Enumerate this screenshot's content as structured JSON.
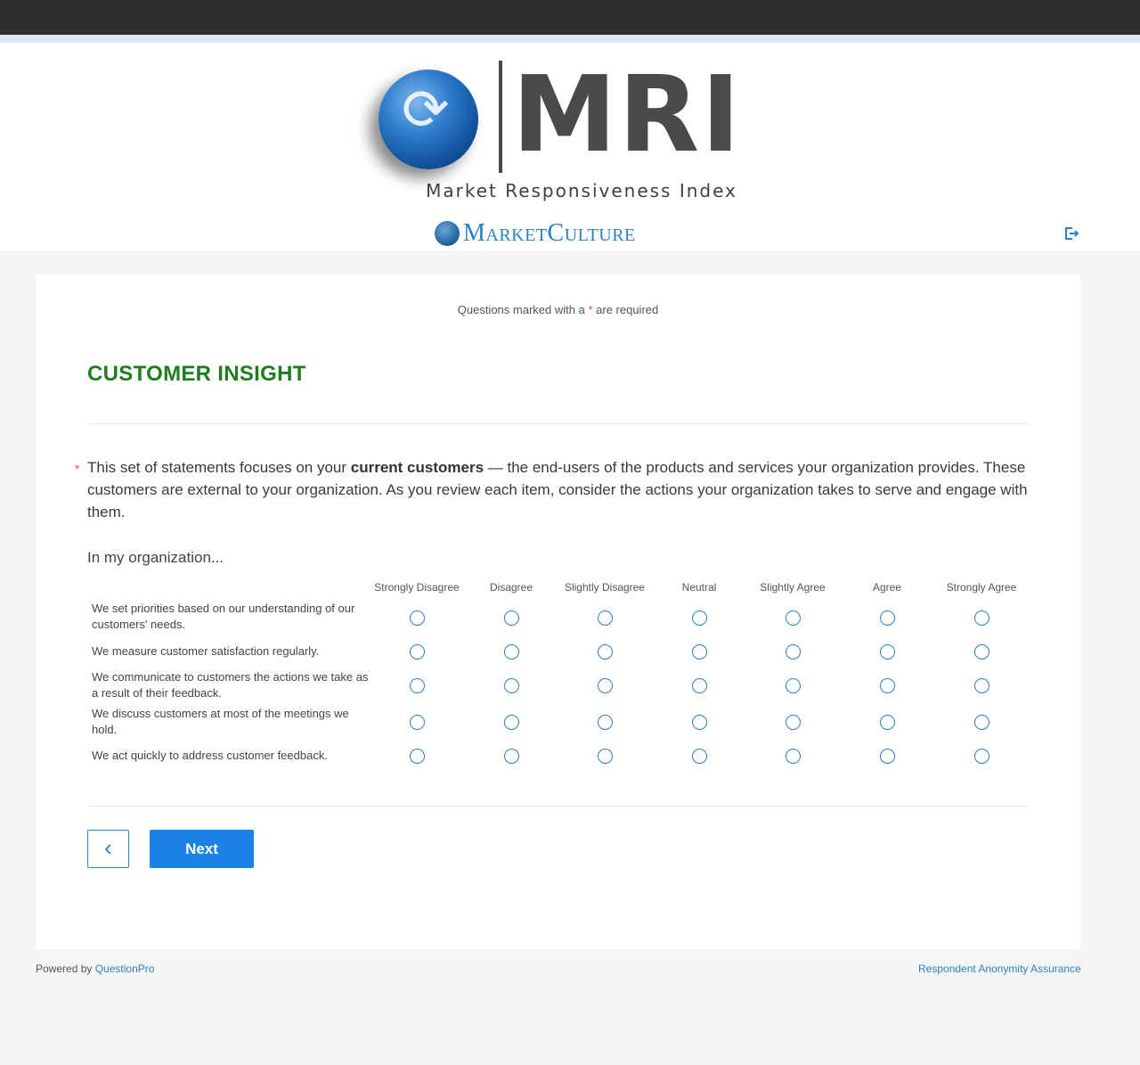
{
  "header": {
    "logo_text": "MRI",
    "logo_subtitle": "Market Responsiveness Index",
    "brand_name": "MarketCulture",
    "logout_icon": "logout-icon"
  },
  "survey": {
    "required_note_prefix": "Questions marked with a",
    "required_star": "*",
    "required_note_suffix": "are required",
    "section_title": "CUSTOMER INSIGHT",
    "question": {
      "required_marker": "*",
      "text_part1": "This set of statements focuses on your ",
      "text_bold": "current customers",
      "text_part2": " — the end-users of the products and services your organization provides. These customers are external to your organization. As you review each item, consider the actions your organization takes to serve and engage with them."
    },
    "matrix_intro": "In my organization...",
    "scale": [
      "Strongly Disagree",
      "Disagree",
      "Slightly Disagree",
      "Neutral",
      "Slightly Agree",
      "Agree",
      "Strongly Agree"
    ],
    "rows": [
      "We set priorities based on our understanding of our customers' needs.",
      "We measure customer satisfaction regularly.",
      "We communicate to customers the actions we take as a result of their feedback.",
      "We discuss customers at most of the meetings we hold.",
      "We act quickly to address customer feedback."
    ]
  },
  "navigation": {
    "back_label": "‹",
    "next_label": "Next"
  },
  "footer": {
    "powered_by": "Powered by",
    "powered_link": "QuestionPro",
    "anonymity_link": "Respondent Anonymity Assurance"
  },
  "colors": {
    "section_title": "#1e7d1e",
    "accent": "#2a82c4",
    "next_button": "#1b83e6"
  }
}
